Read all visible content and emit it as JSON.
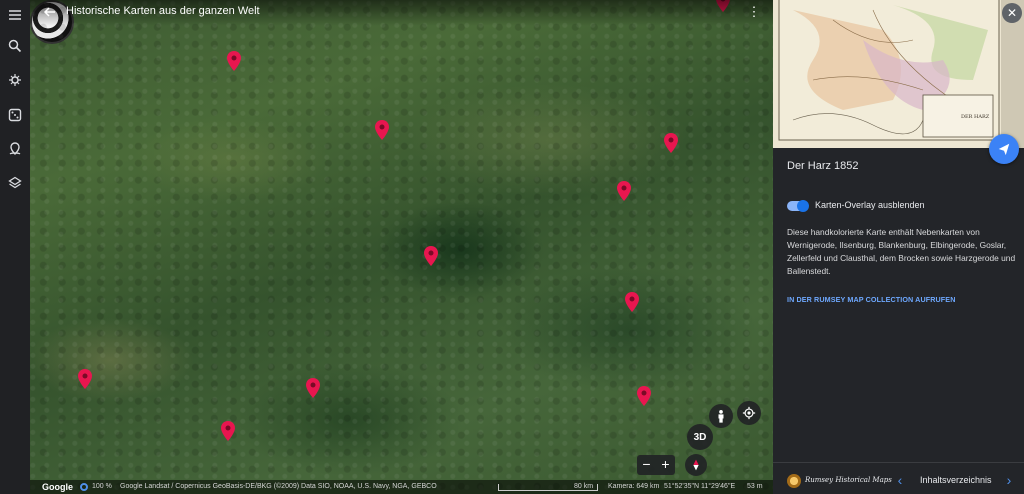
{
  "header": {
    "title": "Historische Karten aus der ganzen Welt"
  },
  "rail": {
    "icons": [
      "menu-icon",
      "search-icon",
      "voyager-icon",
      "dice-icon",
      "projects-icon",
      "layers-icon"
    ]
  },
  "map": {
    "pins": 12
  },
  "controls": {
    "view_3d_label": "3D",
    "zoom_out": "−",
    "zoom_in": "+"
  },
  "statusbar": {
    "google": "Google",
    "load_percent": "100 %",
    "attribution": "Google  Landsat / Copernicus  GeoBasis-DE/BKG (©2009)  Data SIO, NOAA, U.S. Navy, NGA, GEBCO",
    "scale": "80 km",
    "camera": "Kamera: 649 km",
    "coords": "51°52'35\"N 11°29'46\"E",
    "elevation": "53 m"
  },
  "panel": {
    "title": "Der Harz 1852",
    "toggle_label": "Karten-Overlay ausblenden",
    "toggle_on": true,
    "description": "Diese handkolorierte Karte enthält Nebenkarten von Wernigerode, Ilsenburg, Blankenburg, Elbingerode, Goslar, Zellerfeld und Clausthal, dem Brocken sowie Harzgerode und Ballenstedt.",
    "link": "IN DER RUMSEY MAP COLLECTION AUFRUFEN",
    "map_caption": "DER HARZ",
    "footer": {
      "logo_text": "Rumsey Historical Maps",
      "toc": "Inhaltsverzeichnis",
      "prev": "‹",
      "next": "›"
    }
  },
  "colors": {
    "accent": "#1a73e8",
    "pin": "#e8164f",
    "panel_bg": "#232529"
  }
}
